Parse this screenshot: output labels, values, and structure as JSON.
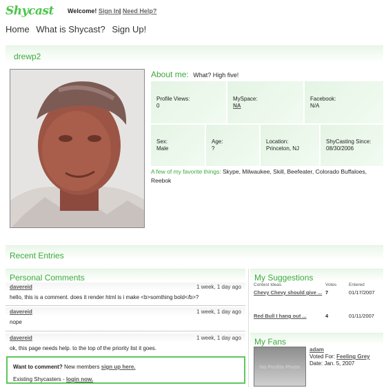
{
  "header": {
    "logo": "Shycast",
    "welcome": "Welcome!",
    "sign_in": "Sign In",
    "sep": "|",
    "help": "Need Help?"
  },
  "nav": [
    "Home",
    "What is Shycast?",
    "Sign Up!"
  ],
  "profile": {
    "username": "drewp2",
    "about_label": "About me:",
    "about_text": "What? High five!",
    "grid1": [
      {
        "label": "Profile Views:",
        "value": "0"
      },
      {
        "label": "MySpace:",
        "value": "NA"
      },
      {
        "label": "Facebook:",
        "value": "N/A"
      }
    ],
    "grid2": [
      {
        "label": "Sex:",
        "value": "Male"
      },
      {
        "label": "Age:",
        "value": "?"
      },
      {
        "label": "Location:",
        "value": "Princeton, NJ"
      },
      {
        "label": "ShyCasting Since:",
        "value": "08/30/2006"
      }
    ],
    "fav_label": "A few of my favorite things:",
    "fav_text": "Skype, Milwaukee, Skill, Beefeater, Colorado Buffaloes, Reebok"
  },
  "recent_entries": {
    "title": "Recent Entries"
  },
  "comments": {
    "title": "Personal Comments",
    "items": [
      {
        "author": "davereid",
        "when": "1 week, 1 day ago",
        "text": "hello, this is a comment. does it render html is i make <b>somthing bold</b>?"
      },
      {
        "author": "davereid",
        "when": "1 week, 1 day ago",
        "text": "nope"
      },
      {
        "author": "davereid",
        "when": "1 week, 1 day ago",
        "text": "ok, this page needs help. to the top of the priority list it goes."
      }
    ],
    "want_label": "Want to comment?",
    "new_members": "New members",
    "sign_up_link": "sign up here.",
    "existing": "Existing Shycasters -",
    "login_link": "login now."
  },
  "suggestions": {
    "title": "My Suggestions",
    "headers": [
      "Contest Ideas",
      "Votes",
      "Entered"
    ],
    "rows": [
      {
        "idea": "Chevy Chevy should give ...",
        "votes": "7",
        "entered": "01/17/2007"
      },
      {
        "idea": "Red Bull I hang out ...",
        "votes": "4",
        "entered": "01/11/2007"
      }
    ]
  },
  "fans": {
    "title": "My Fans",
    "no_photo": "No Profile Photo",
    "name": "adam",
    "voted_label": "Voted For:",
    "voted_link": "Feeling Grey",
    "date": "Date: Jan. 5, 2007"
  }
}
